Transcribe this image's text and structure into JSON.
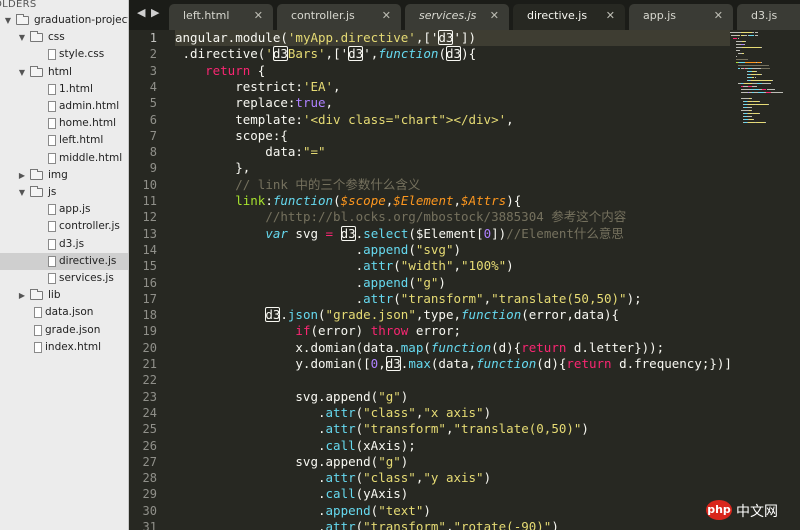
{
  "sidebar": {
    "header": "OLDERS",
    "tree": [
      {
        "label": "graduation-project",
        "kind": "folder",
        "open": true,
        "depth": 0
      },
      {
        "label": "css",
        "kind": "folder",
        "open": true,
        "depth": 1
      },
      {
        "label": "style.css",
        "kind": "file",
        "depth": 2
      },
      {
        "label": "html",
        "kind": "folder",
        "open": true,
        "depth": 1
      },
      {
        "label": "1.html",
        "kind": "file",
        "depth": 2
      },
      {
        "label": "admin.html",
        "kind": "file",
        "depth": 2
      },
      {
        "label": "home.html",
        "kind": "file",
        "depth": 2
      },
      {
        "label": "left.html",
        "kind": "file",
        "depth": 2
      },
      {
        "label": "middle.html",
        "kind": "file",
        "depth": 2
      },
      {
        "label": "img",
        "kind": "folder",
        "open": false,
        "depth": 1
      },
      {
        "label": "js",
        "kind": "folder",
        "open": true,
        "depth": 1
      },
      {
        "label": "app.js",
        "kind": "file",
        "depth": 2
      },
      {
        "label": "controller.js",
        "kind": "file",
        "depth": 2
      },
      {
        "label": "d3.js",
        "kind": "file",
        "depth": 2
      },
      {
        "label": "directive.js",
        "kind": "file",
        "depth": 2,
        "selected": true
      },
      {
        "label": "services.js",
        "kind": "file",
        "depth": 2
      },
      {
        "label": "lib",
        "kind": "folder",
        "open": false,
        "depth": 1
      },
      {
        "label": "data.json",
        "kind": "file",
        "depth": 1
      },
      {
        "label": "grade.json",
        "kind": "file",
        "depth": 1
      },
      {
        "label": "index.html",
        "kind": "file",
        "depth": 1
      }
    ]
  },
  "tabs": [
    {
      "label": "left.html",
      "active": false,
      "italic": false,
      "close": "✕"
    },
    {
      "label": "controller.js",
      "active": false,
      "italic": false,
      "close": "✕"
    },
    {
      "label": "services.js",
      "active": false,
      "italic": true,
      "close": "✕"
    },
    {
      "label": "directive.js",
      "active": true,
      "italic": false,
      "close": "✕"
    },
    {
      "label": "app.js",
      "active": false,
      "italic": false,
      "close": "✕"
    },
    {
      "label": "d3.js",
      "active": false,
      "italic": false,
      "close": "✕"
    }
  ],
  "nav": {
    "back": "◀",
    "forward": "▶"
  },
  "editor": {
    "current_line": 1,
    "lines": [
      {
        "n": "1",
        "t": [
          [
            "p",
            "angular.module("
          ],
          [
            "s",
            "'myApp.directive'"
          ],
          [
            "p",
            ",['"
          ],
          [
            "b",
            "d3"
          ],
          [
            "p",
            "'])"
          ]
        ]
      },
      {
        "n": "2",
        "t": [
          [
            "p",
            " .directive("
          ],
          [
            "s",
            "'"
          ],
          [
            "b",
            "d3"
          ],
          [
            "s",
            "Bars'"
          ],
          [
            "p",
            ",['"
          ],
          [
            "b",
            "d3"
          ],
          [
            "p",
            "',"
          ],
          [
            "f",
            "function"
          ],
          [
            "p",
            "("
          ],
          [
            "b",
            "d3"
          ],
          [
            "p",
            "){"
          ]
        ]
      },
      {
        "n": "3",
        "t": [
          [
            "p",
            "    "
          ],
          [
            "k",
            "return"
          ],
          [
            "p",
            " {"
          ]
        ]
      },
      {
        "n": "4",
        "t": [
          [
            "p",
            "        restrict:"
          ],
          [
            "s",
            "'EA'"
          ],
          [
            "p",
            ","
          ]
        ]
      },
      {
        "n": "5",
        "t": [
          [
            "p",
            "        replace:"
          ],
          [
            "n",
            "true"
          ],
          [
            "p",
            ","
          ]
        ]
      },
      {
        "n": "6",
        "t": [
          [
            "p",
            "        template:"
          ],
          [
            "s",
            "'<div class=\"chart\"></div>'"
          ],
          [
            "p",
            ","
          ]
        ]
      },
      {
        "n": "7",
        "t": [
          [
            "p",
            "        scope:{"
          ]
        ]
      },
      {
        "n": "8",
        "t": [
          [
            "p",
            "            data:"
          ],
          [
            "s",
            "\"=\""
          ]
        ]
      },
      {
        "n": "9",
        "t": [
          [
            "p",
            "        },"
          ]
        ]
      },
      {
        "n": "10",
        "t": [
          [
            "p",
            "        "
          ],
          [
            "c",
            "// link 中的三个参数什么含义"
          ]
        ]
      },
      {
        "n": "11",
        "t": [
          [
            "p",
            "        "
          ],
          [
            "a",
            "link"
          ],
          [
            "p",
            ":"
          ],
          [
            "f",
            "function"
          ],
          [
            "p",
            "("
          ],
          [
            "r",
            "$scope"
          ],
          [
            "p",
            ","
          ],
          [
            "r",
            "$Element"
          ],
          [
            "p",
            ","
          ],
          [
            "r",
            "$Attrs"
          ],
          [
            "p",
            "){"
          ]
        ]
      },
      {
        "n": "12",
        "t": [
          [
            "p",
            "            "
          ],
          [
            "c",
            "//http://bl.ocks.org/mbostock/3885304 参考这个内容"
          ]
        ]
      },
      {
        "n": "13",
        "t": [
          [
            "p",
            "            "
          ],
          [
            "f",
            "var"
          ],
          [
            "p",
            " svg "
          ],
          [
            "k",
            "="
          ],
          [
            "p",
            " "
          ],
          [
            "b",
            "d3"
          ],
          [
            "p",
            "."
          ],
          [
            "l",
            "select"
          ],
          [
            "p",
            "($Element["
          ],
          [
            "n",
            "0"
          ],
          [
            "p",
            "])"
          ],
          [
            "c",
            "//Element什么意思"
          ]
        ]
      },
      {
        "n": "14",
        "t": [
          [
            "p",
            "                        ."
          ],
          [
            "l",
            "append"
          ],
          [
            "p",
            "("
          ],
          [
            "s",
            "\"svg\""
          ],
          [
            "p",
            ")"
          ]
        ]
      },
      {
        "n": "15",
        "t": [
          [
            "p",
            "                        ."
          ],
          [
            "l",
            "attr"
          ],
          [
            "p",
            "("
          ],
          [
            "s",
            "\"width\""
          ],
          [
            "p",
            ","
          ],
          [
            "s",
            "\"100%\""
          ],
          [
            "p",
            ")"
          ]
        ]
      },
      {
        "n": "16",
        "t": [
          [
            "p",
            "                        ."
          ],
          [
            "l",
            "append"
          ],
          [
            "p",
            "("
          ],
          [
            "s",
            "\"g\""
          ],
          [
            "p",
            ")"
          ]
        ]
      },
      {
        "n": "17",
        "t": [
          [
            "p",
            "                        ."
          ],
          [
            "l",
            "attr"
          ],
          [
            "p",
            "("
          ],
          [
            "s",
            "\"transform\""
          ],
          [
            "p",
            ","
          ],
          [
            "s",
            "\"translate(50,50)\""
          ],
          [
            "p",
            ");"
          ]
        ]
      },
      {
        "n": "18",
        "t": [
          [
            "p",
            "            "
          ],
          [
            "b",
            "d3"
          ],
          [
            "p",
            "."
          ],
          [
            "l",
            "json"
          ],
          [
            "p",
            "("
          ],
          [
            "s",
            "\"grade.json\""
          ],
          [
            "p",
            ",type,"
          ],
          [
            "f",
            "function"
          ],
          [
            "p",
            "(error,data){"
          ]
        ]
      },
      {
        "n": "19",
        "t": [
          [
            "p",
            "                "
          ],
          [
            "k",
            "if"
          ],
          [
            "p",
            "(error) "
          ],
          [
            "k",
            "throw"
          ],
          [
            "p",
            " error;"
          ]
        ]
      },
      {
        "n": "20",
        "t": [
          [
            "p",
            "                x.domian(data."
          ],
          [
            "l",
            "map"
          ],
          [
            "p",
            "("
          ],
          [
            "f",
            "function"
          ],
          [
            "p",
            "(d){"
          ],
          [
            "k",
            "return"
          ],
          [
            "p",
            " d.letter}));"
          ]
        ]
      },
      {
        "n": "21",
        "t": [
          [
            "p",
            "                y.domian(["
          ],
          [
            "n",
            "0"
          ],
          [
            "p",
            ","
          ],
          [
            "b",
            "d3"
          ],
          [
            "p",
            "."
          ],
          [
            "l",
            "max"
          ],
          [
            "p",
            "(data,"
          ],
          [
            "f",
            "function"
          ],
          [
            "p",
            "(d){"
          ],
          [
            "k",
            "return"
          ],
          [
            "p",
            " d.frequency;})]);"
          ]
        ]
      },
      {
        "n": "22",
        "t": []
      },
      {
        "n": "23",
        "t": [
          [
            "p",
            "                svg.append("
          ],
          [
            "s",
            "\"g\""
          ],
          [
            "p",
            ")"
          ]
        ]
      },
      {
        "n": "24",
        "t": [
          [
            "p",
            "                   ."
          ],
          [
            "l",
            "attr"
          ],
          [
            "p",
            "("
          ],
          [
            "s",
            "\"class\""
          ],
          [
            "p",
            ","
          ],
          [
            "s",
            "\"x axis\""
          ],
          [
            "p",
            ")"
          ]
        ]
      },
      {
        "n": "25",
        "t": [
          [
            "p",
            "                   ."
          ],
          [
            "l",
            "attr"
          ],
          [
            "p",
            "("
          ],
          [
            "s",
            "\"transform\""
          ],
          [
            "p",
            ","
          ],
          [
            "s",
            "\"translate(0,50)\""
          ],
          [
            "p",
            ")"
          ]
        ]
      },
      {
        "n": "26",
        "t": [
          [
            "p",
            "                   ."
          ],
          [
            "l",
            "call"
          ],
          [
            "p",
            "(xAxis);"
          ]
        ]
      },
      {
        "n": "27",
        "t": [
          [
            "p",
            "                svg.append("
          ],
          [
            "s",
            "\"g\""
          ],
          [
            "p",
            ")"
          ]
        ]
      },
      {
        "n": "28",
        "t": [
          [
            "p",
            "                   ."
          ],
          [
            "l",
            "attr"
          ],
          [
            "p",
            "("
          ],
          [
            "s",
            "\"class\""
          ],
          [
            "p",
            ","
          ],
          [
            "s",
            "\"y axis\""
          ],
          [
            "p",
            ")"
          ]
        ]
      },
      {
        "n": "29",
        "t": [
          [
            "p",
            "                   ."
          ],
          [
            "l",
            "call"
          ],
          [
            "p",
            "(yAxis)"
          ]
        ]
      },
      {
        "n": "30",
        "t": [
          [
            "p",
            "                   ."
          ],
          [
            "l",
            "append"
          ],
          [
            "p",
            "("
          ],
          [
            "s",
            "\"text\""
          ],
          [
            "p",
            ")"
          ]
        ]
      },
      {
        "n": "31",
        "t": [
          [
            "p",
            "                   ."
          ],
          [
            "l",
            "attr"
          ],
          [
            "p",
            "("
          ],
          [
            "s",
            "\"transform\""
          ],
          [
            "p",
            ","
          ],
          [
            "s",
            "\"rotate(-90)\""
          ],
          [
            "p",
            ")"
          ]
        ]
      }
    ]
  },
  "watermark": {
    "logo": "php",
    "text": "中文网"
  },
  "colors": {
    "bg": "#272822",
    "string": "#e6db74",
    "keyword": "#f92672",
    "function": "#66d9ef",
    "param": "#fd971f",
    "comment": "#75715e",
    "number": "#ae81ff",
    "attr": "#a6e22e"
  }
}
